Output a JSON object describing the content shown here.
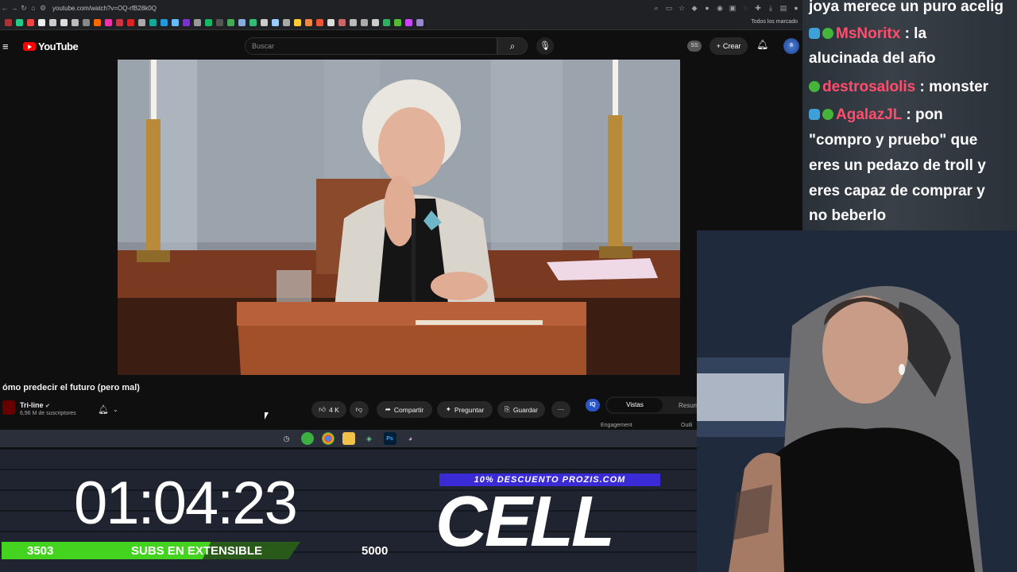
{
  "browser": {
    "url": "youtube.com/watch?v=OQ-rfB28k0Q",
    "bookmarks_all_label": "Todos los marcado"
  },
  "youtube": {
    "logo_text": "YouTube",
    "search_placeholder": "Buscar",
    "ss_badge": "SS",
    "create_label": "Crear",
    "avatar_text": "ꔮ"
  },
  "video": {
    "title": "ómo predecir el futuro (pero mal)",
    "channel_name": "Tri-line",
    "subscribers": "6,96 M de suscriptores",
    "likes": "4 K",
    "share_label": "Compartir",
    "ask_label": "Preguntar",
    "save_label": "Guardar"
  },
  "side_panel": {
    "badge": "IQ",
    "tab_active": "Vistas",
    "tab_other": "Resum",
    "engagement_label": "Engagement",
    "outline_label": "Outli"
  },
  "overlay": {
    "timer": "01:04:23",
    "subs_current": "3503",
    "subs_label": "SUBS EN EXTENSIBLE",
    "subs_goal": "5000",
    "subs_progress": 0.7006,
    "promo": "10% DESCUENTO PROZIS.COM",
    "brand": "CELL"
  },
  "chat": [
    {
      "user": "",
      "text": "joya merece un puro acelig",
      "badges": []
    },
    {
      "user": "MsNoritx",
      "text": ": la",
      "badges": [
        "cube",
        "gem"
      ]
    },
    {
      "user": "",
      "text": "alucinada del año",
      "badges": []
    },
    {
      "user": "destrosalolis",
      "text": ": monster",
      "badges": [
        "gem"
      ]
    },
    {
      "user": "AgalazJL",
      "text": ": pon",
      "badges": [
        "cube",
        "gem"
      ]
    },
    {
      "user": "",
      "text": "\"compro y pruebo\" que",
      "badges": []
    },
    {
      "user": "",
      "text": "eres un pedazo de troll y",
      "badges": []
    },
    {
      "user": "",
      "text": "eres capaz de comprar y",
      "badges": []
    },
    {
      "user": "",
      "text": "no beberlo",
      "badges": []
    }
  ]
}
